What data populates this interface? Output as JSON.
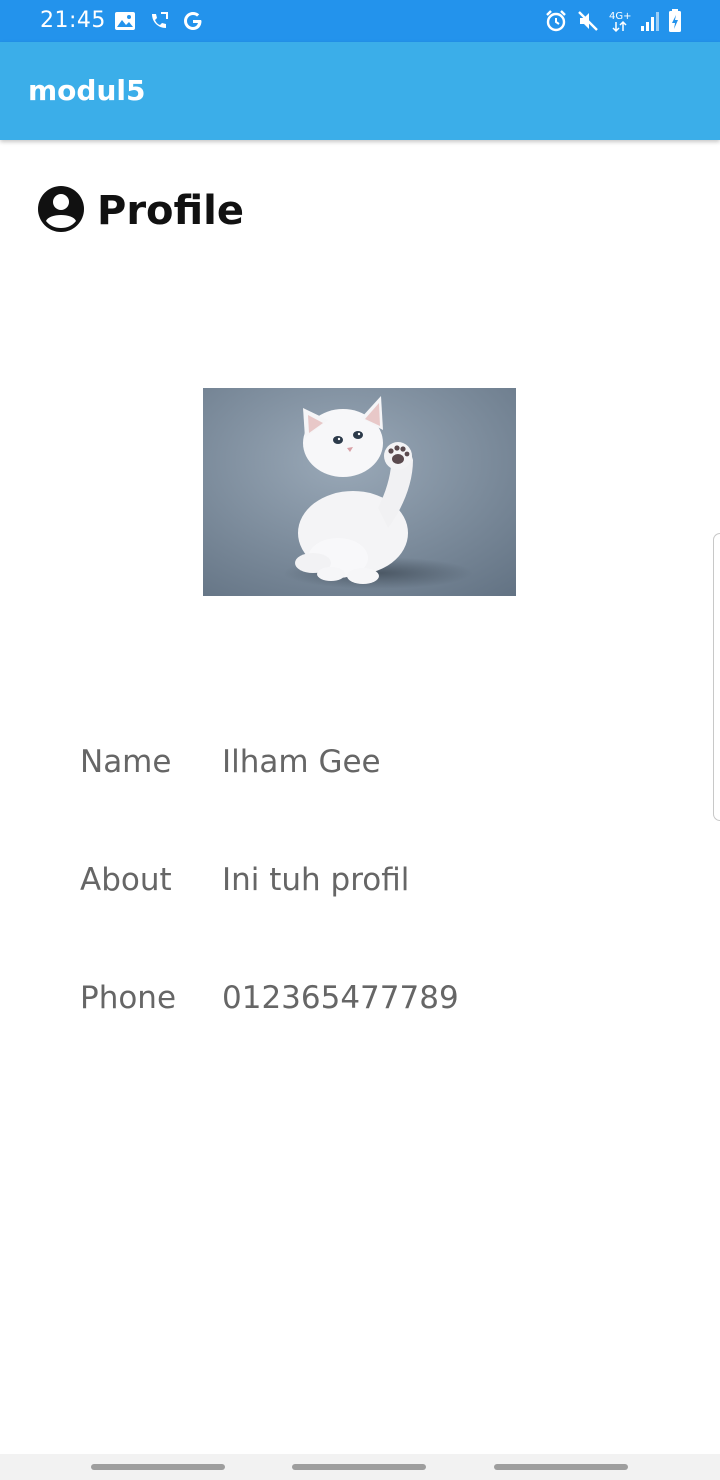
{
  "status_bar": {
    "time": "21:45",
    "left_icons": [
      "image-icon",
      "call-forward-icon",
      "google-icon"
    ],
    "right_icons": [
      "alarm-icon",
      "mute-icon",
      "network-4g-icon",
      "signal-icon",
      "battery-charging-icon"
    ],
    "network_label": "4G+"
  },
  "app_bar": {
    "title": "modul5",
    "color": "#3baee9"
  },
  "profile": {
    "heading": "Profile",
    "heading_icon": "account-circle-icon",
    "photo": "white-kitten-photo"
  },
  "info": [
    {
      "label": "Name",
      "value": "Ilham Gee"
    },
    {
      "label": "About",
      "value": "Ini tuh profil"
    },
    {
      "label": "Phone",
      "value": "012365477789"
    }
  ],
  "colors": {
    "status_bar": "#2393ec",
    "app_bar": "#3baee9",
    "label_text": "#666666",
    "heading_text": "#111111"
  }
}
